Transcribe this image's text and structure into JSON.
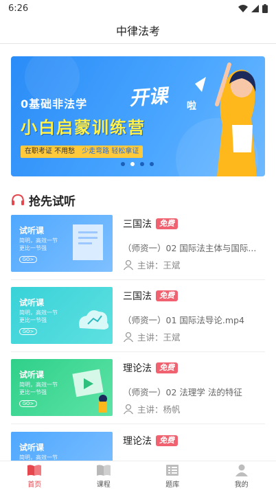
{
  "status": {
    "time": "6:26"
  },
  "header": {
    "title": "中律法考"
  },
  "banner": {
    "line1": "0基础非法学",
    "line2": "小白启蒙训练营",
    "headline": "开课",
    "headline_suffix": "啦",
    "tag_main": "在职考证 不用愁",
    "tag_sub": "少走弯路 轻松拿证"
  },
  "section": {
    "title": "抢先试听"
  },
  "thumb_text": {
    "title": "试听课",
    "line1": "简明，高效一节",
    "line2": "更比一节强",
    "go": "GO>"
  },
  "courses": [
    {
      "name": "三国法",
      "badge": "免费",
      "desc": "（师资一）02 国际法主体与国际...",
      "teacher": "主讲：王斌"
    },
    {
      "name": "三国法",
      "badge": "免费",
      "desc": "（师资一）01 国际法导论.mp4",
      "teacher": "主讲：王斌"
    },
    {
      "name": "理论法",
      "badge": "免费",
      "desc": "（师资一）02 法理学 法的特征",
      "teacher": "主讲：杨帆"
    },
    {
      "name": "理论法",
      "badge": "免费",
      "desc": "",
      "teacher": ""
    }
  ],
  "tabs": [
    {
      "label": "首页",
      "icon": "book-open-icon"
    },
    {
      "label": "课程",
      "icon": "book-icon"
    },
    {
      "label": "题库",
      "icon": "list-icon"
    },
    {
      "label": "我的",
      "icon": "person-icon"
    }
  ],
  "colors": {
    "accent": "#e5474f",
    "badge": "#f0626f",
    "banner": "#2a8cf7"
  }
}
